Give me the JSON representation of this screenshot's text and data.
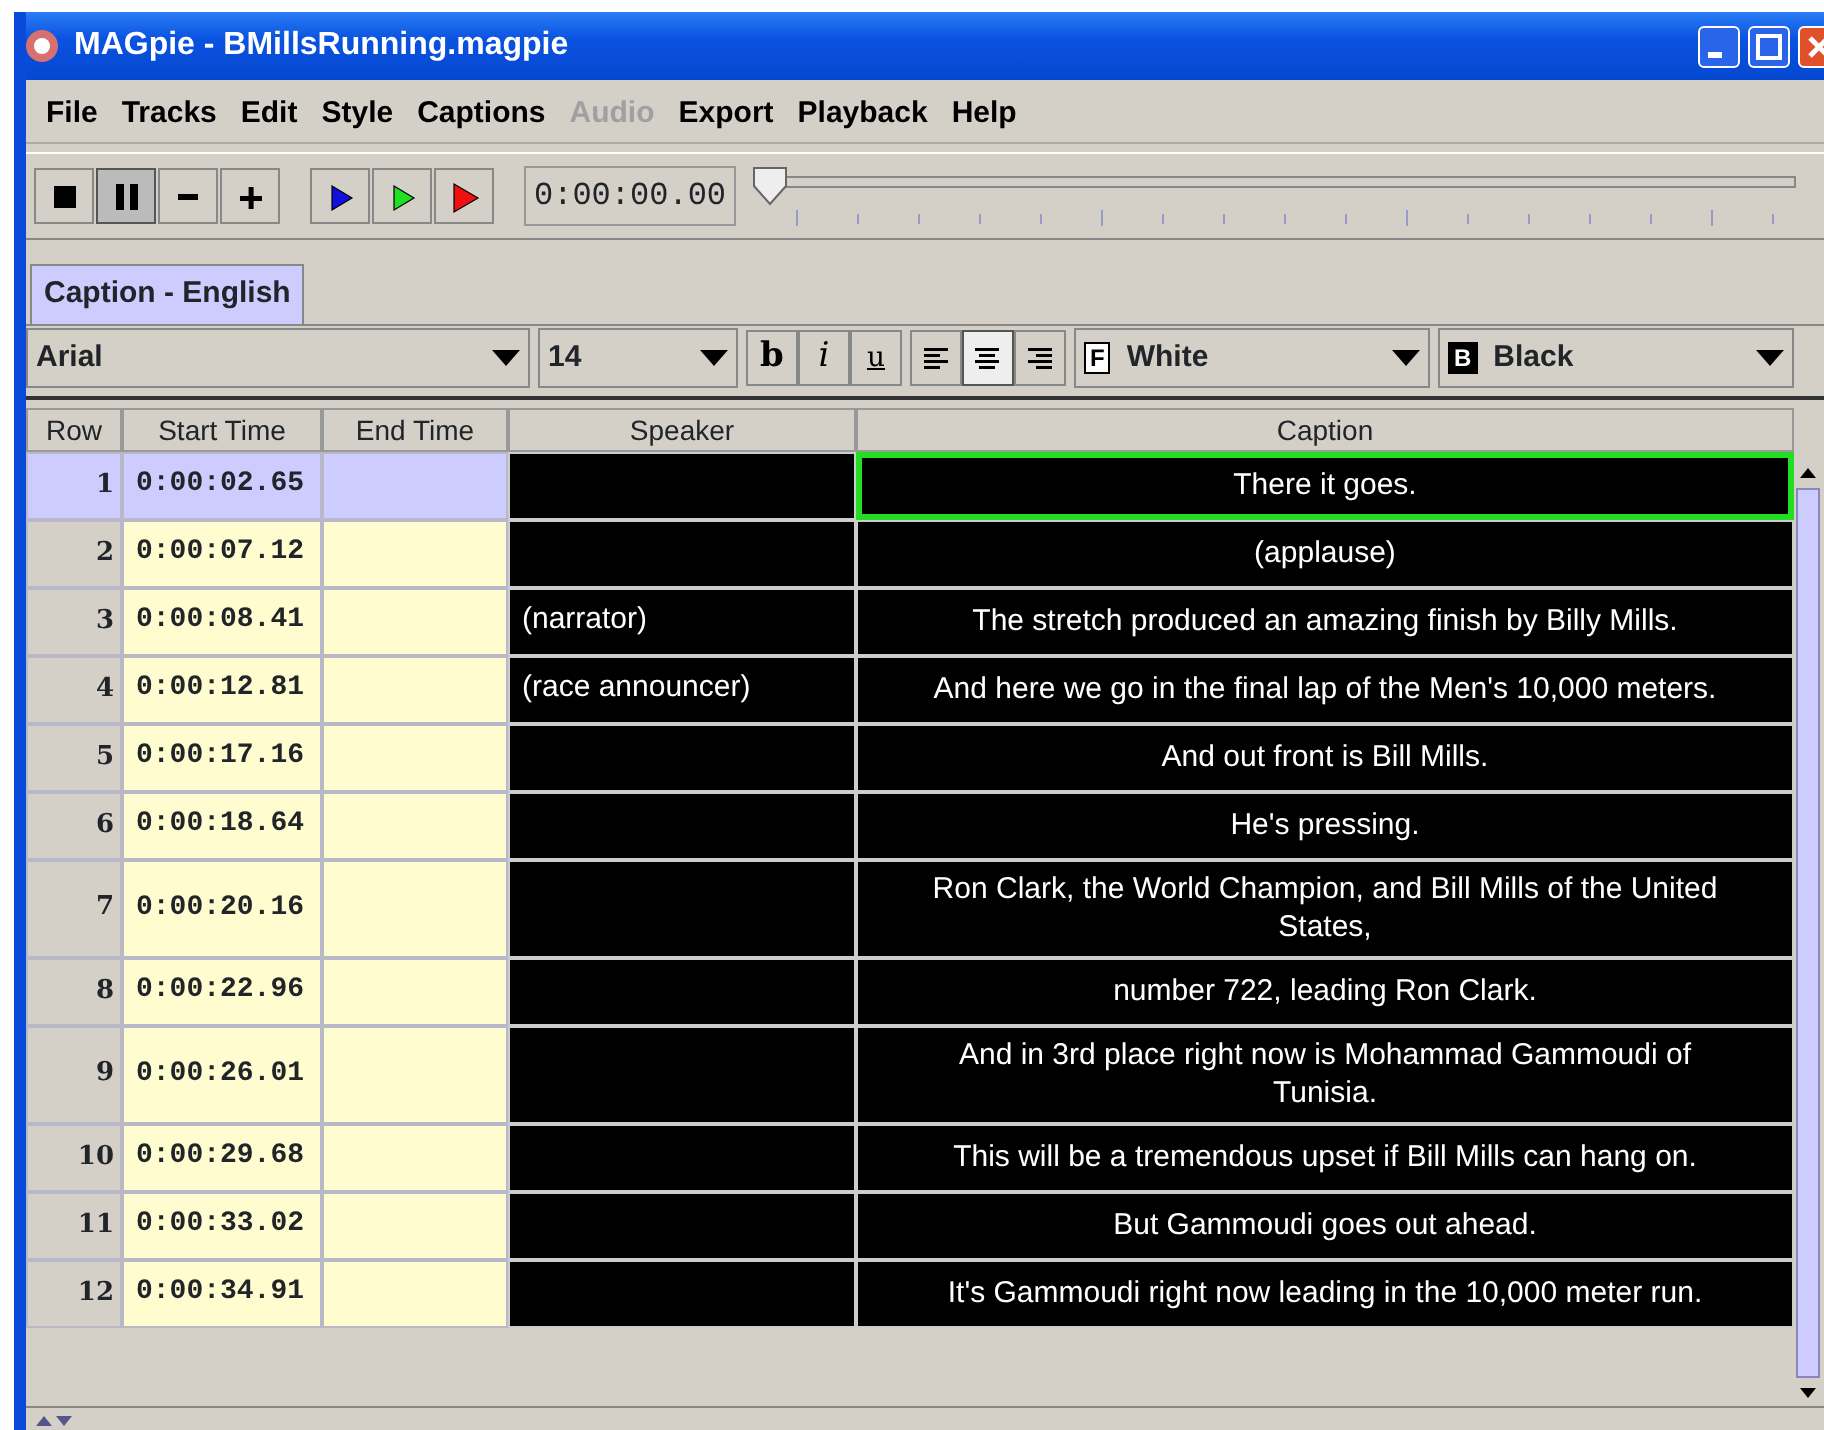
{
  "window": {
    "title": "MAGpie - BMillsRunning.magpie"
  },
  "menu": [
    {
      "label": "File",
      "disabled": false
    },
    {
      "label": "Tracks",
      "disabled": false
    },
    {
      "label": "Edit",
      "disabled": false
    },
    {
      "label": "Style",
      "disabled": false
    },
    {
      "label": "Captions",
      "disabled": false
    },
    {
      "label": "Audio",
      "disabled": true
    },
    {
      "label": "Export",
      "disabled": false
    },
    {
      "label": "Playback",
      "disabled": false
    },
    {
      "label": "Help",
      "disabled": false
    }
  ],
  "transport": [
    {
      "kind": "stop",
      "pressed": false
    },
    {
      "kind": "pause",
      "pressed": true
    },
    {
      "kind": "minus",
      "pressed": false
    },
    {
      "kind": "plus",
      "pressed": false
    },
    {
      "kind": "play-blue",
      "pressed": false
    },
    {
      "kind": "play-green",
      "pressed": false
    },
    {
      "kind": "play-red",
      "pressed": false
    }
  ],
  "time": "0:00:00.00",
  "position": {
    "level": 0
  },
  "tabs": [
    {
      "label": "Caption - English",
      "selected": true
    }
  ],
  "format": {
    "font": "Arial",
    "size": "14",
    "styles": [
      {
        "kind": "bold",
        "label": "b",
        "selected": false
      },
      {
        "kind": "italic",
        "label": "i",
        "selected": false
      },
      {
        "kind": "underline",
        "label": "u",
        "selected": false
      }
    ],
    "align": [
      {
        "kind": "left",
        "selected": false
      },
      {
        "kind": "center",
        "selected": true
      },
      {
        "kind": "right",
        "selected": false
      }
    ],
    "foreground": {
      "letter": "F",
      "label": "White"
    },
    "background": {
      "letter": "B",
      "label": "Black"
    }
  },
  "table": {
    "columns": [
      "Row",
      "Start Time",
      "End Time",
      "Speaker",
      "Caption"
    ],
    "rows": [
      {
        "row": "1",
        "start": "0:00:02.65",
        "speaker": "",
        "caption": "There it goes.",
        "selected": true
      },
      {
        "row": "2",
        "start": "0:00:07.12",
        "speaker": "",
        "caption": "(applause)",
        "selected": false
      },
      {
        "row": "3",
        "start": "0:00:08.41",
        "speaker": "(narrator)",
        "caption": "The stretch produced an amazing finish by Billy Mills.",
        "selected": false
      },
      {
        "row": "4",
        "start": "0:00:12.81",
        "speaker": "(race announcer)",
        "caption": "And here we go in the final lap of the Men's 10,000 meters.",
        "selected": false
      },
      {
        "row": "5",
        "start": "0:00:17.16",
        "speaker": "",
        "caption": "And out front is Bill Mills.",
        "selected": false
      },
      {
        "row": "6",
        "start": "0:00:18.64",
        "speaker": "",
        "caption": "He's pressing.",
        "selected": false
      },
      {
        "row": "7",
        "start": "0:00:20.16",
        "speaker": "",
        "caption": "Ron Clark, the World Champion, and Bill Mills of the United States,",
        "selected": false
      },
      {
        "row": "8",
        "start": "0:00:22.96",
        "speaker": "",
        "caption": "number 722, leading Ron Clark.",
        "selected": false
      },
      {
        "row": "9",
        "start": "0:00:26.01",
        "speaker": "",
        "caption": "And in 3rd place right now is Mohammad Gammoudi of Tunisia.",
        "selected": false
      },
      {
        "row": "10",
        "start": "0:00:29.68",
        "speaker": "",
        "caption": "This will be a tremendous upset if Bill Mills can hang on.",
        "selected": false
      },
      {
        "row": "11",
        "start": "0:00:33.02",
        "speaker": "",
        "caption": "But Gammoudi goes out ahead.",
        "selected": false
      },
      {
        "row": "12",
        "start": "0:00:34.91",
        "speaker": "",
        "caption": "It's Gammoudi right now leading in the 10,000 meter run.",
        "selected": false
      }
    ]
  }
}
